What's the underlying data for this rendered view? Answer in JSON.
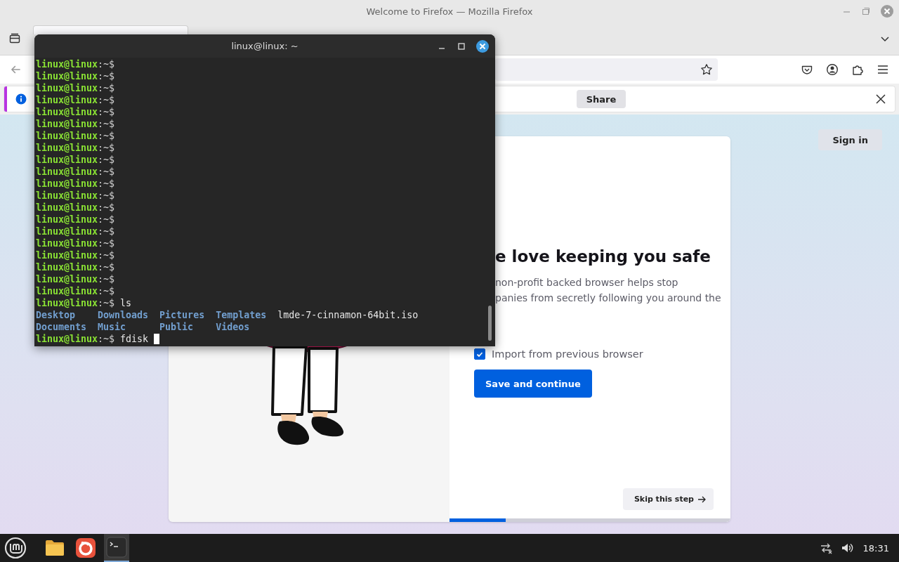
{
  "browser": {
    "title": "Welcome to Firefox — Mozilla Firefox",
    "tabs": [
      {
        "selected": true
      }
    ],
    "notification": {
      "share_button": "Share"
    },
    "sign_in": "Sign in",
    "card": {
      "heading": "e love keeping you safe",
      "description_lines": [
        "non-profit backed browser helps stop",
        "panies from secretly following you around the"
      ],
      "checkbox": {
        "label": "Import from previous browser",
        "checked": true
      },
      "primary_button": "Save and continue",
      "skip_button": "Skip this step",
      "progress": {
        "level": 0.2
      }
    }
  },
  "terminal": {
    "title": "linux@linux: ~",
    "cursor_visible": true,
    "lines": [
      {
        "kind": "prompt",
        "user": "linux@linux",
        "path": ":~$"
      },
      {
        "kind": "prompt",
        "user": "linux@linux",
        "path": ":~$"
      },
      {
        "kind": "prompt",
        "user": "linux@linux",
        "path": ":~$"
      },
      {
        "kind": "prompt",
        "user": "linux@linux",
        "path": ":~$"
      },
      {
        "kind": "prompt",
        "user": "linux@linux",
        "path": ":~$"
      },
      {
        "kind": "prompt",
        "user": "linux@linux",
        "path": ":~$"
      },
      {
        "kind": "prompt",
        "user": "linux@linux",
        "path": ":~$"
      },
      {
        "kind": "prompt",
        "user": "linux@linux",
        "path": ":~$"
      },
      {
        "kind": "prompt",
        "user": "linux@linux",
        "path": ":~$"
      },
      {
        "kind": "prompt",
        "user": "linux@linux",
        "path": ":~$"
      },
      {
        "kind": "prompt",
        "user": "linux@linux",
        "path": ":~$"
      },
      {
        "kind": "prompt",
        "user": "linux@linux",
        "path": ":~$"
      },
      {
        "kind": "prompt",
        "user": "linux@linux",
        "path": ":~$"
      },
      {
        "kind": "prompt",
        "user": "linux@linux",
        "path": ":~$"
      },
      {
        "kind": "prompt",
        "user": "linux@linux",
        "path": ":~$"
      },
      {
        "kind": "prompt",
        "user": "linux@linux",
        "path": ":~$"
      },
      {
        "kind": "prompt",
        "user": "linux@linux",
        "path": ":~$"
      },
      {
        "kind": "prompt",
        "user": "linux@linux",
        "path": ":~$"
      },
      {
        "kind": "prompt",
        "user": "linux@linux",
        "path": ":~$"
      },
      {
        "kind": "prompt",
        "user": "linux@linux",
        "path": ":~$"
      },
      {
        "kind": "prompt",
        "user": "linux@linux",
        "path": ":~$",
        "command": "ls"
      },
      {
        "kind": "listing",
        "entries": [
          {
            "text": "Desktop",
            "kind": "directory"
          },
          {
            "text": "Downloads",
            "kind": "directory"
          },
          {
            "text": "Pictures",
            "kind": "directory"
          },
          {
            "text": "Templates",
            "kind": "directory"
          },
          {
            "text": "lmde-7-cinnamon-64bit.iso",
            "kind": "file"
          }
        ]
      },
      {
        "kind": "listing",
        "entries": [
          {
            "text": "Documents",
            "kind": "directory"
          },
          {
            "text": "Music",
            "kind": "directory"
          },
          {
            "text": "Public",
            "kind": "directory"
          },
          {
            "text": "Videos",
            "kind": "directory"
          }
        ]
      },
      {
        "kind": "prompt",
        "user": "linux@linux",
        "path": ":~$",
        "command": "fdisk"
      }
    ]
  },
  "taskbar": {
    "apps": [
      {
        "kind": "files",
        "selected": false
      },
      {
        "kind": "browser",
        "selected": false
      },
      {
        "kind": "terminal",
        "selected": true
      }
    ],
    "clock": "18:31"
  }
}
